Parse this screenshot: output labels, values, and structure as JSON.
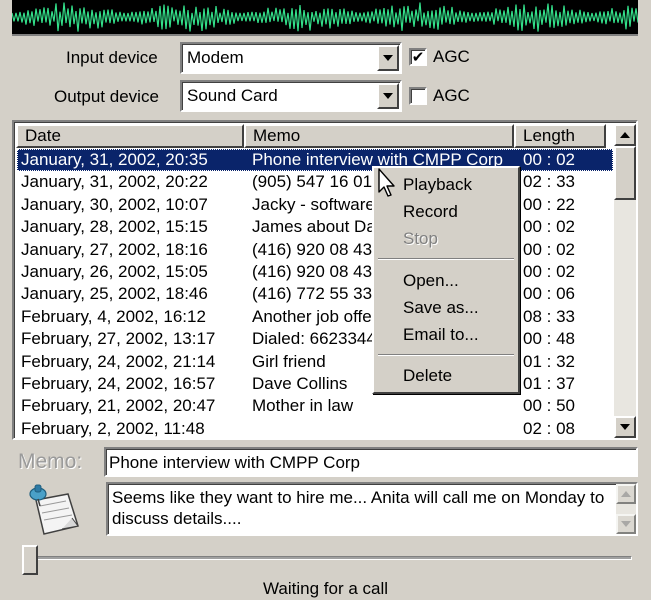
{
  "devices": {
    "input_label": "Input device",
    "input_value": "Modem",
    "input_agc_label": "AGC",
    "input_agc_checked": true,
    "output_label": "Output device",
    "output_value": "Sound Card",
    "output_agc_label": "AGC",
    "output_agc_checked": false
  },
  "list": {
    "columns": {
      "date": "Date",
      "memo": "Memo",
      "length": "Length"
    },
    "rows": [
      {
        "date": "January, 31, 2002, 20:35",
        "memo": "Phone interview with CMPP Corp",
        "length": "00 : 02",
        "selected": true
      },
      {
        "date": "January, 31, 2002, 20:22",
        "memo": "(905) 547 16 01",
        "length": "02 : 33"
      },
      {
        "date": "January, 30, 2002, 10:07",
        "memo": "Jacky - software",
        "length": "00 : 22"
      },
      {
        "date": "January, 28, 2002, 15:15",
        "memo": "James about Da",
        "length": "00 : 02"
      },
      {
        "date": "January, 27, 2002, 18:16",
        "memo": "(416) 920 08 43",
        "length": "00 : 02"
      },
      {
        "date": "January, 26, 2002, 15:05",
        "memo": "(416) 920 08 43",
        "length": "00 : 02"
      },
      {
        "date": "January, 25, 2002, 18:46",
        "memo": "(416) 772 55 33",
        "length": "00 : 06"
      },
      {
        "date": "February, 4, 2002, 16:12",
        "memo": "Another job offe",
        "length": "08 : 33"
      },
      {
        "date": "February, 27, 2002, 13:17",
        "memo": "Dialed: 6623344",
        "length": "00 : 48"
      },
      {
        "date": "February, 24, 2002, 21:14",
        "memo": "Girl friend",
        "length": "01 : 32"
      },
      {
        "date": "February, 24, 2002, 16:57",
        "memo": "Dave Collins",
        "length": "01 : 37"
      },
      {
        "date": "February, 21, 2002, 20:47",
        "memo": "Mother in law",
        "length": "00 : 50"
      },
      {
        "date": "February, 2, 2002, 11:48",
        "memo": "",
        "length": "02 : 08"
      }
    ]
  },
  "context_menu": {
    "playback": "Playback",
    "record": "Record",
    "stop": "Stop",
    "open": "Open...",
    "save_as": "Save as...",
    "email_to": "Email to...",
    "delete": "Delete"
  },
  "memo": {
    "label": "Memo:",
    "value": "Phone interview with CMPP Corp",
    "notes": "Seems like they want to hire me... Anita will call me on Monday to discuss details...."
  },
  "status": "Waiting for a call",
  "colors": {
    "waveform": "#33e08a",
    "selection": "#0a246a",
    "face": "#d4d0c8"
  }
}
